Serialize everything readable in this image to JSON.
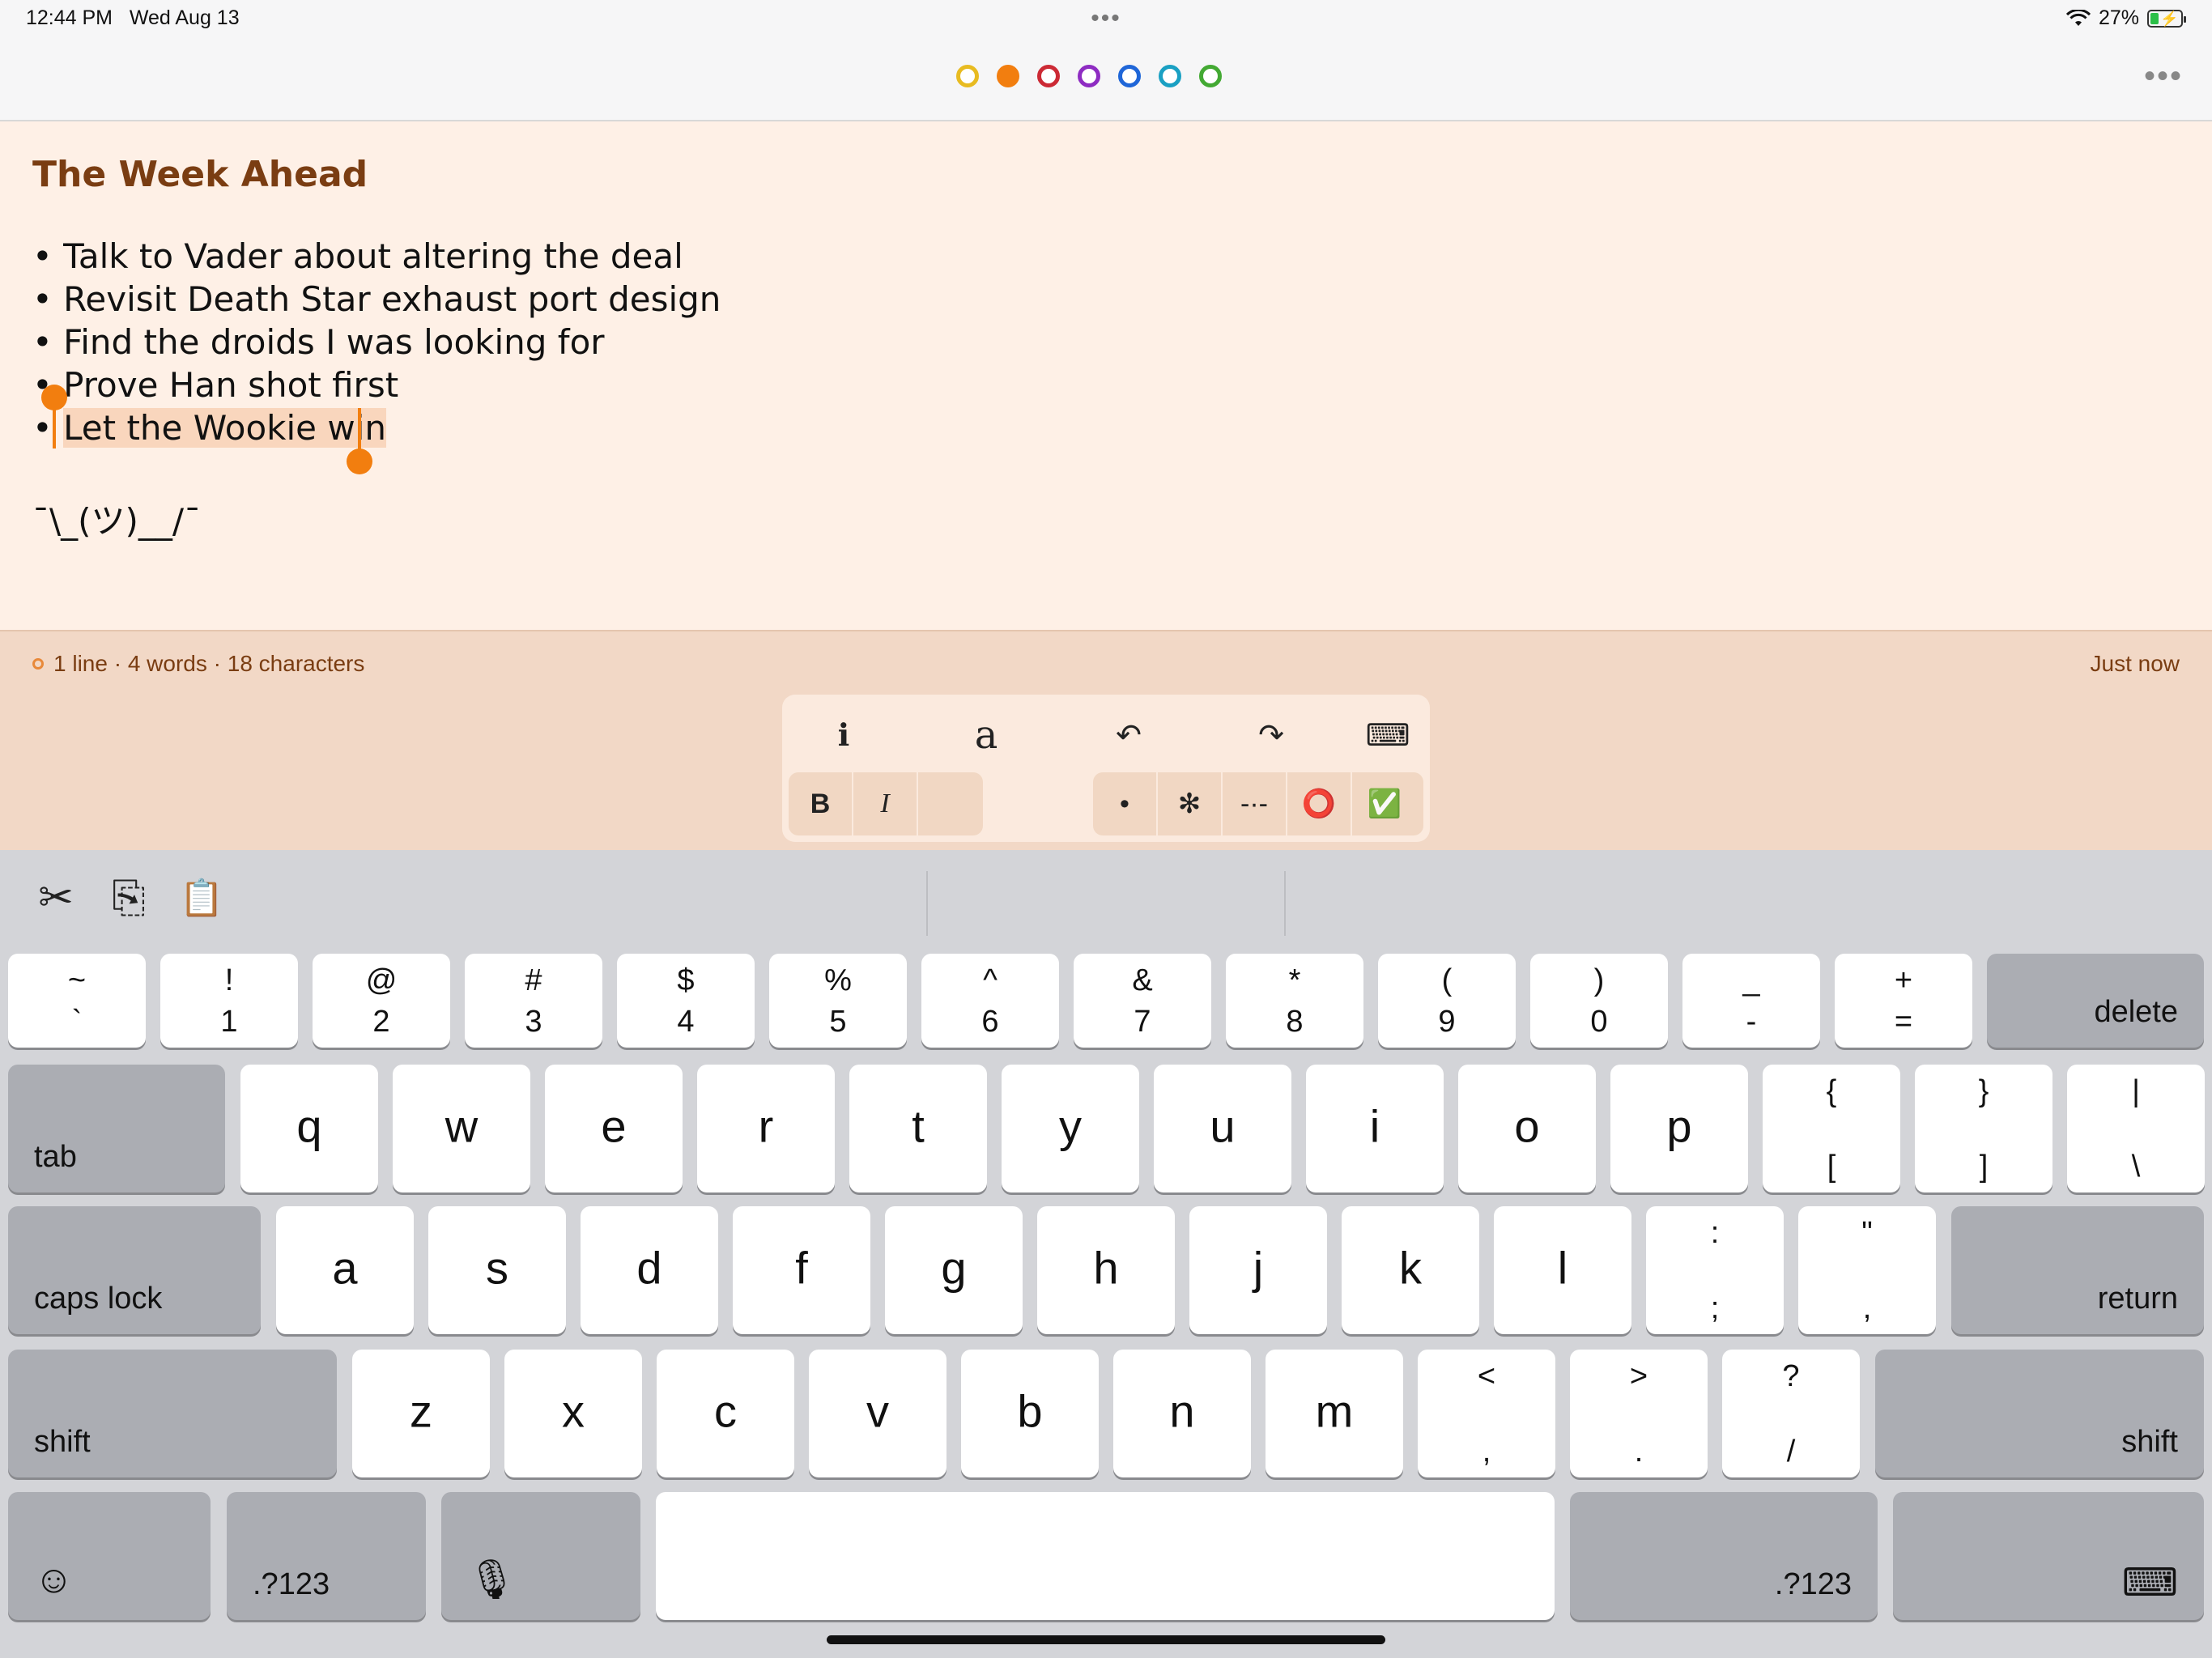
{
  "status": {
    "time": "12:44 PM",
    "date": "Wed Aug 13",
    "battery": "27%",
    "battery_level": 0.27,
    "more_dots": "•••"
  },
  "colors": [
    "#e8bb21",
    "#f27e0f",
    "#cc2a35",
    "#8e2cc2",
    "#1f66d8",
    "#1aa0c3",
    "#43a933"
  ],
  "selected_color": "#f27e0f",
  "note": {
    "title": "The Week Ahead",
    "lines": [
      "• Talk to Vader about altering the deal",
      "• Revisit Death Star exhaust port design",
      "• Find the droids I was looking for",
      "• Prove Han shot first",
      "• "
    ],
    "selected_text": "Let the Wookie win",
    "shrug": "¯\\_(ツ)__/¯"
  },
  "footer": {
    "stats": "1 line · 4 words · 18 characters",
    "timestamp": "Just now"
  },
  "toolbar": {
    "info": "ℹ",
    "font": "a",
    "undo": "↶",
    "redo": "↷",
    "keyboard": "⌨",
    "bold": "B",
    "italic": "I",
    "bullet": "•",
    "asterisk": "✻",
    "dash": "-·-",
    "circle": "⭕",
    "check": "✅"
  },
  "shortcuts": {
    "cut": "✂",
    "copy": "⎘",
    "paste": "📋"
  },
  "keys": {
    "num": [
      {
        "t": "~",
        "b": "`"
      },
      {
        "t": "!",
        "b": "1"
      },
      {
        "t": "@",
        "b": "2"
      },
      {
        "t": "#",
        "b": "3"
      },
      {
        "t": "$",
        "b": "4"
      },
      {
        "t": "%",
        "b": "5"
      },
      {
        "t": "^",
        "b": "6"
      },
      {
        "t": "&",
        "b": "7"
      },
      {
        "t": "*",
        "b": "8"
      },
      {
        "t": "(",
        "b": "9"
      },
      {
        "t": ")",
        "b": "0"
      },
      {
        "t": "_",
        "b": "-"
      },
      {
        "t": "+",
        "b": "="
      }
    ],
    "row1": [
      "q",
      "w",
      "e",
      "r",
      "t",
      "y",
      "u",
      "i",
      "o",
      "p"
    ],
    "row1_sym": [
      {
        "t": "{",
        "b": "["
      },
      {
        "t": "}",
        "b": "]"
      },
      {
        "t": "|",
        "b": "\\"
      }
    ],
    "row2": [
      "a",
      "s",
      "d",
      "f",
      "g",
      "h",
      "j",
      "k",
      "l"
    ],
    "row2_sym": [
      {
        "t": ":",
        "b": ";"
      },
      {
        "t": "\"",
        "b": ","
      }
    ],
    "row3": [
      "z",
      "x",
      "c",
      "v",
      "b",
      "n",
      "m"
    ],
    "row3_sym": [
      {
        "t": "<",
        "b": ","
      },
      {
        "t": ">",
        "b": "."
      },
      {
        "t": "?",
        "b": "/"
      }
    ],
    "delete": "delete",
    "tab": "tab",
    "caps": "caps lock",
    "return": "return",
    "shift": "shift",
    "num_toggle": ".?123",
    "emoji": "☺",
    "mic": "🎙",
    "dismiss": "⌨"
  }
}
